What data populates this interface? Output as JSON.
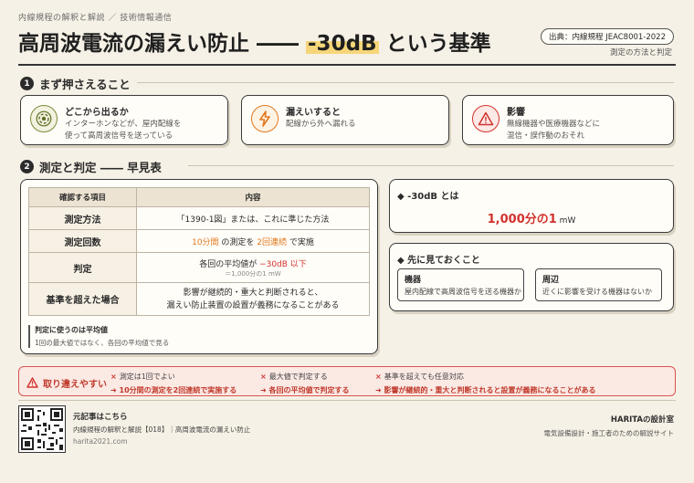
{
  "header": {
    "series": "内線規程の解釈と解説 ／ 技術情報通信",
    "title_before": "高周波電流の漏えい防止 ―― ",
    "title_highlight": "-30dB",
    "title_after": " という基準",
    "source": "出典：内線規程 JEAC8001-2022",
    "method_note": "測定の方法と判定"
  },
  "section1": {
    "num": "1",
    "title": "まず押さえること",
    "cards": [
      {
        "title": "どこから出るか",
        "desc1": "インターホンなどが、屋内配線を",
        "desc2": "使って高周波信号を送っている",
        "icon": "signal-icon"
      },
      {
        "title": "漏えいすると",
        "desc1": "配線から外へ漏れる",
        "desc2": "",
        "icon": "lightning-icon"
      },
      {
        "title": "影響",
        "desc1": "無線機器や医療機器などに",
        "desc2": "混信・誤作動のおそれ",
        "icon": "warning-icon"
      }
    ]
  },
  "section2": {
    "num": "2",
    "title": "測定と判定 ―― 早見表",
    "table": {
      "headers": [
        "確認する項目",
        "内容"
      ],
      "rows": {
        "method": {
          "label": "測定方法",
          "text": "「1390-1図」または、これに準じた方法"
        },
        "count": {
          "label": "測定回数",
          "part1": "10分間",
          "part2": " の測定を ",
          "part3": "2回連続",
          "part4": " で実施"
        },
        "judge": {
          "label": "判定",
          "part1": "各回の平均値が ",
          "part2": "−30dB 以下",
          "part3": "＝1,000分の1 mW"
        },
        "exceed": {
          "label": "基準を超えた場合",
          "line1": "影響が継続的・重大と判断されると、",
          "line2": "漏えい防止装置の設置が義務になることがある"
        }
      }
    },
    "note_title": "判定に使うのは平均値",
    "note_text": "1回の最大値ではなく、各回の平均値で見る"
  },
  "side": {
    "db_title": "-30dB とは",
    "db_value": "1,000分の1",
    "db_unit": " mW",
    "check_title": "先に見ておくこと",
    "box1_title": "機器",
    "box1_desc": "屋内配線で高周波信号を送る機器か",
    "box2_title": "周辺",
    "box2_desc": "近くに影響を受ける機器はないか"
  },
  "warning": {
    "label": "取り違えやすい",
    "items": [
      {
        "q": "測定は1回でよい",
        "a": "10分間の測定を2回連続で実施する"
      },
      {
        "q": "最大値で判定する",
        "a": "各回の平均値で判定する"
      },
      {
        "q": "基準を超えても任意対応",
        "a": "影響が継続的・重大と判断されると設置が義務になることがある"
      }
    ]
  },
  "footer": {
    "ref_title": "元記事はこちら",
    "ref_text": "内線規程の解釈と解説【018】｜高周波電流の漏えい防止",
    "ref_url": "harita2021.com",
    "brand": "HARITAの設計室",
    "tagline": "電気設備設計・施工者のための解説サイト"
  },
  "colors": {
    "accent": "#e0781e",
    "danger": "#d2322d",
    "highlight": "#f6d67a"
  }
}
